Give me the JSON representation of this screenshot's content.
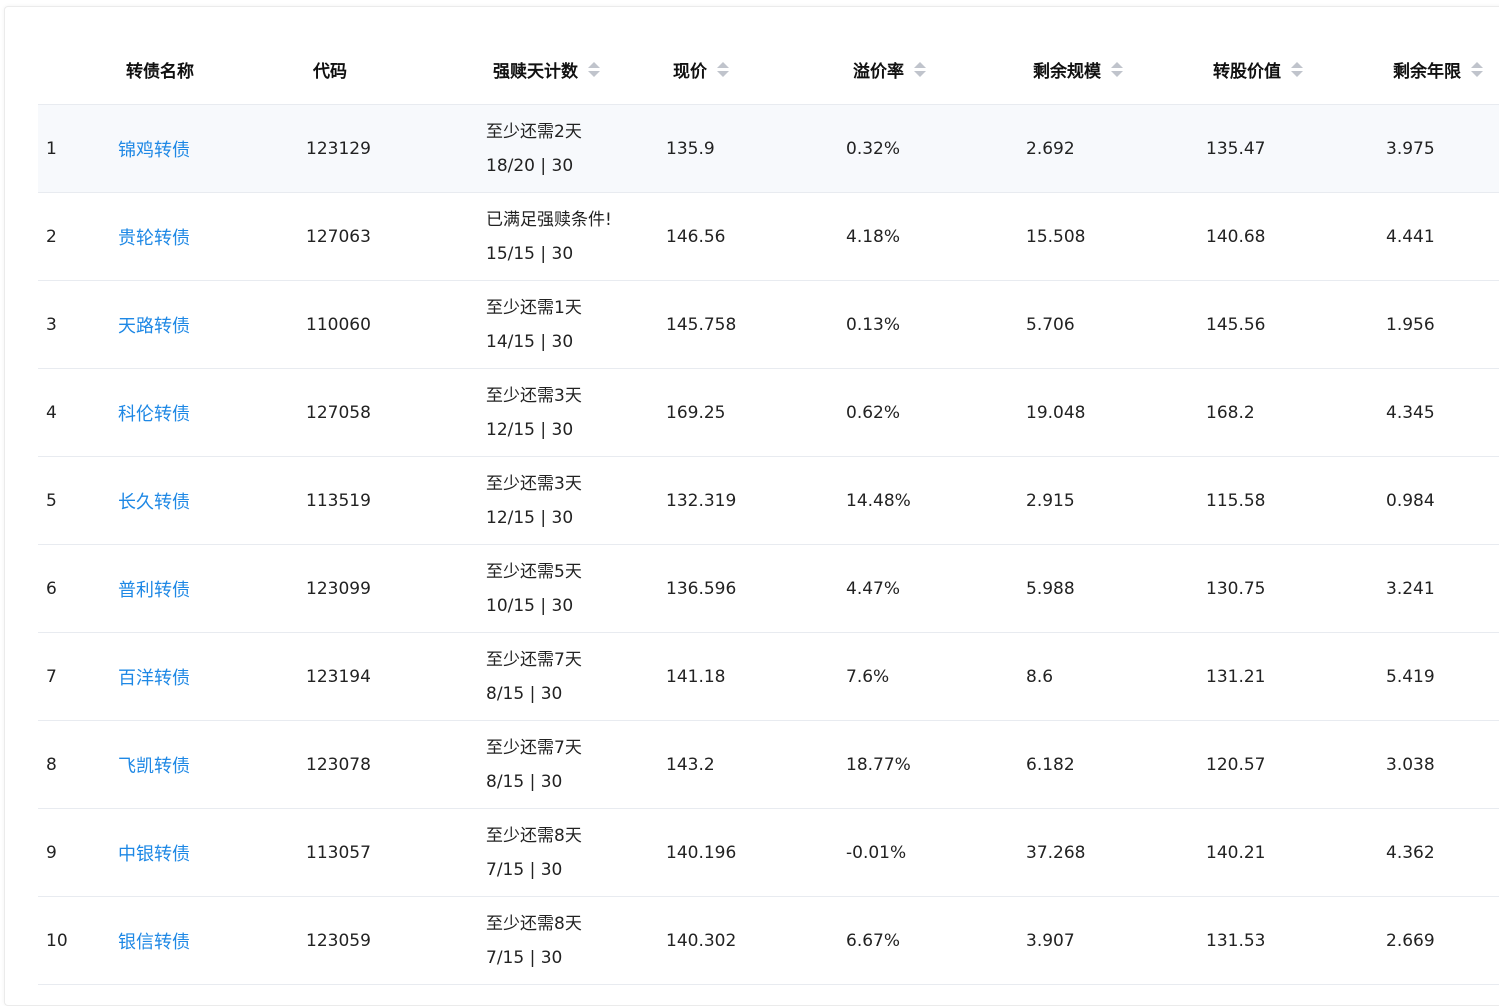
{
  "table": {
    "columns": {
      "name": "转债名称",
      "code": "代码",
      "redeem_count": "强赎天计数",
      "price": "现价",
      "premium": "溢价率",
      "remaining_size": "剩余规模",
      "conversion_value": "转股价值",
      "remaining_years": "剩余年限"
    },
    "rows": [
      {
        "idx": "1",
        "name": "锦鸡转债",
        "code": "123129",
        "redeem_status": "至少还需2天",
        "redeem_progress": "18/20 | 30",
        "price": "135.9",
        "premium": "0.32%",
        "size": "2.692",
        "value": "135.47",
        "years": "3.975"
      },
      {
        "idx": "2",
        "name": "贵轮转债",
        "code": "127063",
        "redeem_status": "已满足强赎条件!",
        "redeem_progress": "15/15 | 30",
        "price": "146.56",
        "premium": "4.18%",
        "size": "15.508",
        "value": "140.68",
        "years": "4.441"
      },
      {
        "idx": "3",
        "name": "天路转债",
        "code": "110060",
        "redeem_status": "至少还需1天",
        "redeem_progress": "14/15 | 30",
        "price": "145.758",
        "premium": "0.13%",
        "size": "5.706",
        "value": "145.56",
        "years": "1.956"
      },
      {
        "idx": "4",
        "name": "科伦转债",
        "code": "127058",
        "redeem_status": "至少还需3天",
        "redeem_progress": "12/15 | 30",
        "price": "169.25",
        "premium": "0.62%",
        "size": "19.048",
        "value": "168.2",
        "years": "4.345"
      },
      {
        "idx": "5",
        "name": "长久转债",
        "code": "113519",
        "redeem_status": "至少还需3天",
        "redeem_progress": "12/15 | 30",
        "price": "132.319",
        "premium": "14.48%",
        "size": "2.915",
        "value": "115.58",
        "years": "0.984"
      },
      {
        "idx": "6",
        "name": "普利转债",
        "code": "123099",
        "redeem_status": "至少还需5天",
        "redeem_progress": "10/15 | 30",
        "price": "136.596",
        "premium": "4.47%",
        "size": "5.988",
        "value": "130.75",
        "years": "3.241"
      },
      {
        "idx": "7",
        "name": "百洋转债",
        "code": "123194",
        "redeem_status": "至少还需7天",
        "redeem_progress": "8/15 | 30",
        "price": "141.18",
        "premium": "7.6%",
        "size": "8.6",
        "value": "131.21",
        "years": "5.419"
      },
      {
        "idx": "8",
        "name": "飞凯转债",
        "code": "123078",
        "redeem_status": "至少还需7天",
        "redeem_progress": "8/15 | 30",
        "price": "143.2",
        "premium": "18.77%",
        "size": "6.182",
        "value": "120.57",
        "years": "3.038"
      },
      {
        "idx": "9",
        "name": "中银转债",
        "code": "113057",
        "redeem_status": "至少还需8天",
        "redeem_progress": "7/15 | 30",
        "price": "140.196",
        "premium": "-0.01%",
        "size": "37.268",
        "value": "140.21",
        "years": "4.362"
      },
      {
        "idx": "10",
        "name": "银信转债",
        "code": "123059",
        "redeem_status": "至少还需8天",
        "redeem_progress": "7/15 | 30",
        "price": "140.302",
        "premium": "6.67%",
        "size": "3.907",
        "value": "131.53",
        "years": "2.669"
      }
    ]
  }
}
